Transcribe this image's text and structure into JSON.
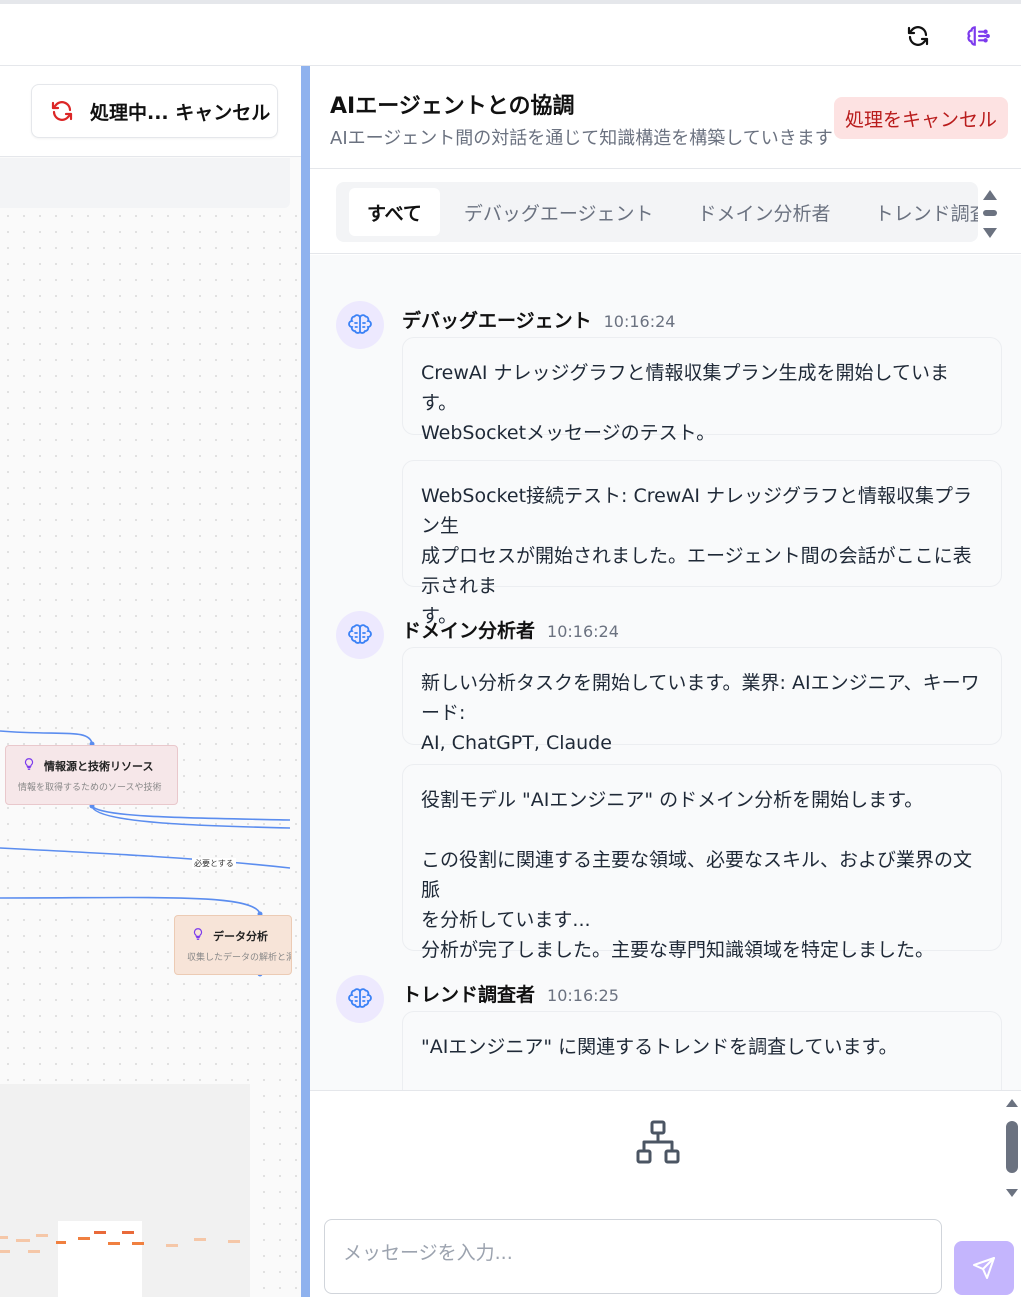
{
  "topbar": {
    "refresh_icon": "refresh-icon",
    "brain_icon": "brain-icon"
  },
  "left_panel": {
    "processing_button_label": "処理中... キャンセル",
    "nodes": [
      {
        "title": "情報源と技術リソース",
        "description": "情報を取得するためのソースや技術"
      },
      {
        "title": "データ分析",
        "description": "収集したデータの解析と洞察の"
      }
    ],
    "edge_label": "必要とする"
  },
  "chat": {
    "title": "AIエージェントとの協調",
    "subtitle": "AIエージェント間の対話を通じて知識構造を構築していきます",
    "cancel_label": "処理をキャンセル",
    "tabs": [
      {
        "label": "すべて",
        "active": true
      },
      {
        "label": "デバッグエージェント",
        "active": false
      },
      {
        "label": "ドメイン分析者",
        "active": false
      },
      {
        "label": "トレンド調査者",
        "active": false
      }
    ],
    "messages": [
      {
        "sender": "デバッグエージェント",
        "time": "10:16:24",
        "bubbles": [
          "CrewAI ナレッジグラフと情報収集プラン生成を開始しています。\nWebSocketメッセージのテスト。",
          "WebSocket接続テスト: CrewAI ナレッジグラフと情報収集プラン生\n成プロセスが開始されました。エージェント間の会話がここに表示されま\nす。"
        ]
      },
      {
        "sender": "ドメイン分析者",
        "time": "10:16:24",
        "bubbles": [
          "新しい分析タスクを開始しています。業界: AIエンジニア、キーワード:\nAI, ChatGPT, Claude",
          "役割モデル \"AIエンジニア\" のドメイン分析を開始します。\n\nこの役割に関連する主要な領域、必要なスキル、および業界の文脈\nを分析しています...\n分析が完了しました。主要な専門知識領域を特定しました。"
        ]
      },
      {
        "sender": "トレンド調査者",
        "time": "10:16:25",
        "bubbles": [
          "\"AIエンジニア\" に関連するトレンドを調査しています。"
        ]
      }
    ],
    "input_placeholder": "メッセージを入力...",
    "send_icon": "send-icon",
    "diagram_icon": "sitemap-icon"
  },
  "colors": {
    "accent": "#c4b5fd",
    "divider": "#8fb2ee",
    "cancel_bg": "#fde2e2",
    "cancel_text": "#b91c1c"
  }
}
